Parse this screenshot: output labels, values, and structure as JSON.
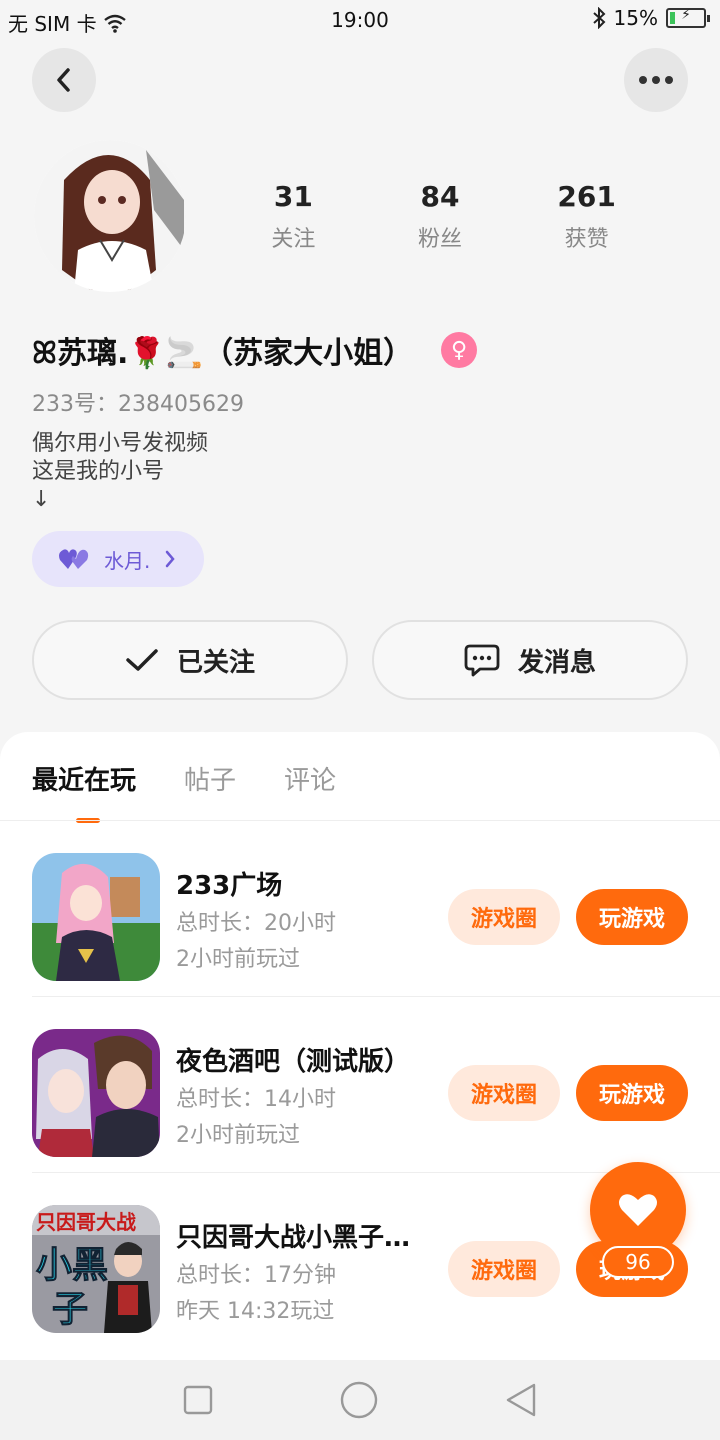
{
  "status_bar": {
    "carrier": "无 SIM 卡",
    "time": "19:00",
    "battery": "15%",
    "battery_level": 0.15
  },
  "profile": {
    "stats": [
      {
        "value": "31",
        "label": "关注"
      },
      {
        "value": "84",
        "label": "粉丝"
      },
      {
        "value": "261",
        "label": "获赞"
      }
    ],
    "username": "ꕤ苏璃.🌹🚬（苏家大小姐）",
    "gender_symbol": "♀",
    "uid": "233号：238405629",
    "bio": [
      "偶尔用小号发视频",
      "这是我的小号",
      "↓"
    ],
    "guild": "水月."
  },
  "actions": {
    "follow_label": "已关注",
    "message_label": "发消息"
  },
  "tabs": [
    {
      "label": "最近在玩"
    },
    {
      "label": "帖子"
    },
    {
      "label": "评论"
    }
  ],
  "games": [
    {
      "title": "233广场",
      "duration": "总时长：20小时",
      "last_played": "2小时前玩过",
      "circle_label": "游戏圈",
      "play_label": "玩游戏"
    },
    {
      "title": "夜色酒吧（测试版）",
      "duration": "总时长：14小时",
      "last_played": "2小时前玩过",
      "circle_label": "游戏圈",
      "play_label": "玩游戏"
    },
    {
      "title": "只因哥大战小黑子…",
      "duration": "总时长：17分钟",
      "last_played": "昨天 14:32玩过",
      "circle_label": "游戏圈",
      "play_label": "玩游戏"
    }
  ],
  "game3_icon_text": {
    "top": "只因哥大战",
    "mid": "小黑",
    "bottom": "子"
  },
  "favorite": {
    "count": "96"
  },
  "colors": {
    "accent": "#ff6a0d",
    "accent_light": "#ffe9dc",
    "guild_bg": "#e7e4fb",
    "guild_text": "#6d5ad6",
    "gender_pink": "#ff7aa2"
  },
  "icons": {
    "back": "chevron-left-icon",
    "more": "more-dots-icon",
    "check": "check-icon",
    "chat": "chat-bubble-icon",
    "heart": "heart-icon",
    "nav": [
      "square-icon",
      "circle-icon",
      "triangle-back-icon"
    ]
  }
}
